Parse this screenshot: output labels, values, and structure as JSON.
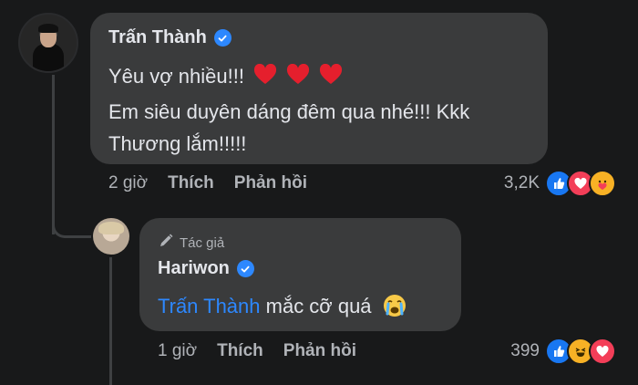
{
  "comment": {
    "author": "Trấn Thành",
    "lines": [
      "Yêu vợ nhiều!!!",
      "Em siêu duyên dáng đêm qua nhé!!! Kkk",
      "Thương lắm!!!!!"
    ],
    "time": "2 giờ",
    "like_label": "Thích",
    "reply_label": "Phản hồi",
    "reaction_count": "3,2K",
    "reactions": [
      "like-icon",
      "love-icon",
      "care-icon"
    ]
  },
  "reply": {
    "badge": "Tác giả",
    "author": "Hariwon",
    "mention": "Trấn Thành",
    "text": " mắc cỡ quá",
    "time": "1 giờ",
    "like_label": "Thích",
    "reply_label": "Phản hồi",
    "reaction_count": "399",
    "reactions": [
      "like-icon",
      "haha-icon",
      "love-icon"
    ]
  },
  "colors": {
    "background": "#18191a",
    "bubble": "#3a3b3c",
    "accent": "#2d88ff",
    "muted": "#b0b3b8"
  }
}
